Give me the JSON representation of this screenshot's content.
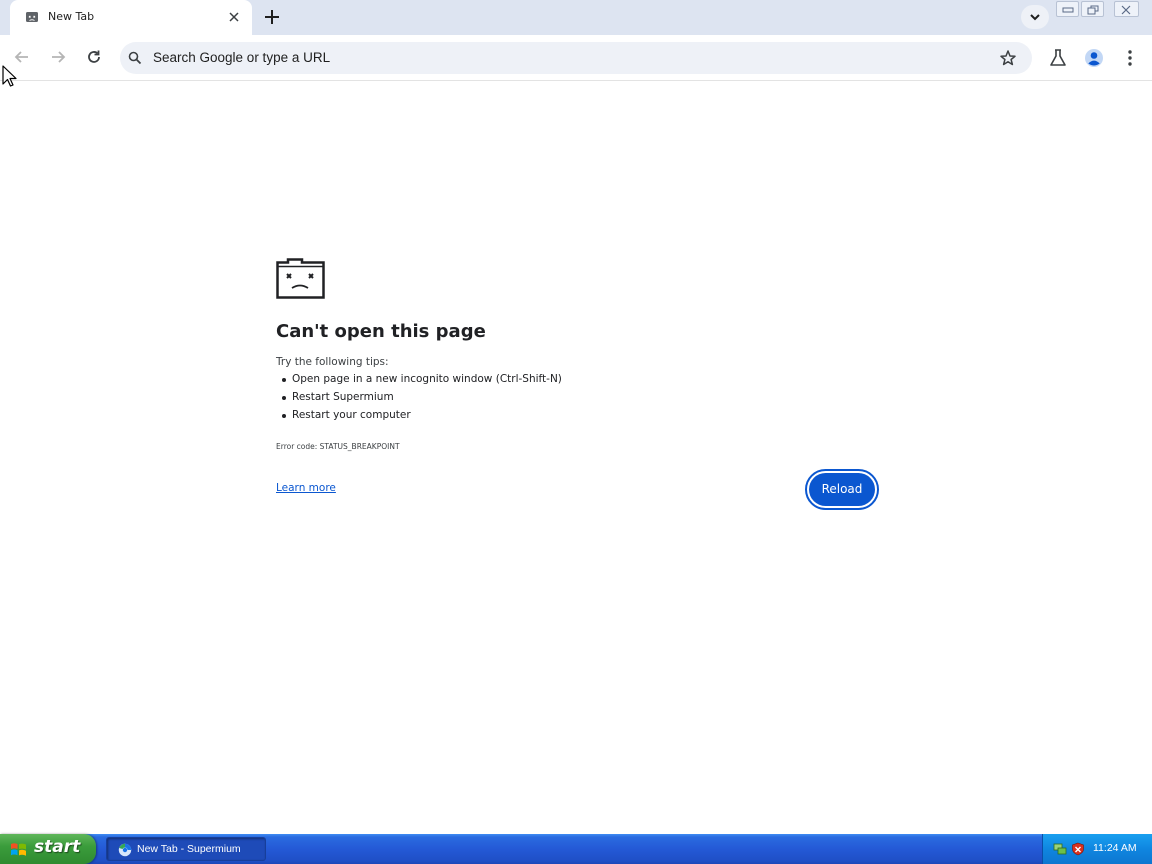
{
  "browser": {
    "tab": {
      "title": "New Tab"
    },
    "omnibox": {
      "placeholder": "Search Google or type a URL"
    }
  },
  "error_page": {
    "title": "Can't open this page",
    "tips_heading": "Try the following tips:",
    "tips": [
      "Open page in a new incognito window (Ctrl-Shift-N)",
      "Restart Supermium",
      "Restart your computer"
    ],
    "error_code": "Error code: STATUS_BREAKPOINT",
    "learn_more": "Learn more",
    "reload_button": "Reload"
  },
  "taskbar": {
    "start_label": "start",
    "task_item": "New Tab - Supermium",
    "clock": "11:24 AM"
  },
  "colors": {
    "accent": "#0b57d0",
    "tabstrip": "#dde4f1",
    "taskbar": "#2459d6",
    "start_green": "#3b9d3c"
  },
  "icons": [
    "sad-folder-icon",
    "close-icon",
    "plus-icon",
    "chevron-down-icon",
    "back-arrow-icon",
    "forward-arrow-icon",
    "reload-icon",
    "search-icon",
    "star-icon",
    "flask-icon",
    "profile-icon",
    "kebab-menu-icon",
    "windows-flag-icon",
    "browser-icon",
    "network-icon",
    "shield-icon"
  ]
}
